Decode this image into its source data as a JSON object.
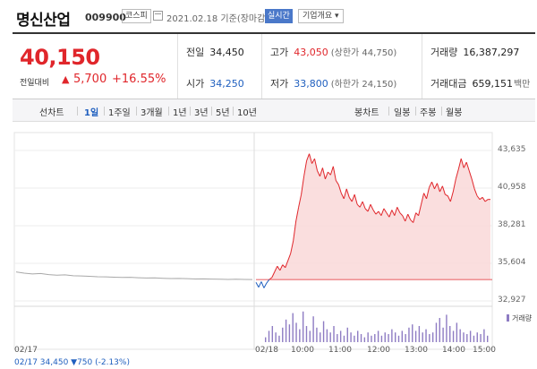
{
  "header": {
    "name": "명신산업",
    "code": "009900",
    "market": "코스피",
    "date": "2021.02.18 기준(장마감)",
    "realtime": "실시간",
    "company_info": "기업개요 ▾"
  },
  "quote": {
    "price": "40,150",
    "change_label": "전일대비",
    "change_arrow": "▲",
    "change": "5,700",
    "rate": "+16.55%",
    "prev_close_label": "전일",
    "prev_close": "34,450",
    "open_label": "시가",
    "open": "34,250",
    "high_label": "고가",
    "high": "43,050",
    "upper_limit": "(상한가 44,750)",
    "low_label": "저가",
    "low": "33,800",
    "lower_limit": "(하한가 24,150)",
    "volume_label": "거래량",
    "volume": "16,387,297",
    "amount_label": "거래대금",
    "amount": "659,151",
    "amount_unit": "백만"
  },
  "period_bar": {
    "line_chart_label": "선차트",
    "periods": [
      "1일",
      "1주일",
      "3개월",
      "1년",
      "3년",
      "5년",
      "10년"
    ],
    "active_period": "1일",
    "candle_chart_label": "봉차트",
    "candles": [
      "일봉",
      "주봉",
      "월봉"
    ]
  },
  "chart_data": {
    "type": "line",
    "y_ticks": [
      "43,635",
      "40,958",
      "38,281",
      "35,604",
      "32,927"
    ],
    "ylim": [
      32927,
      43635
    ],
    "x_ticks": [
      "02/17",
      "02/18",
      "10:00",
      "11:00",
      "12:00",
      "13:00",
      "14:00",
      "15:00"
    ],
    "reference_price": 34450,
    "colors": {
      "prev_day": "#a8a8a8",
      "up": "#e0262b",
      "down": "#1f5fbf",
      "fill": "#f9d8d8",
      "volume": "#8e7cc3"
    },
    "prev_day_series": [
      34990,
      34900,
      34850,
      34880,
      34800,
      34760,
      34780,
      34720,
      34700,
      34680,
      34650,
      34640,
      34620,
      34600,
      34610,
      34580,
      34560,
      34570,
      34540,
      34520,
      34530,
      34510,
      34490,
      34500,
      34480,
      34470,
      34460,
      34470,
      34455,
      34450
    ],
    "today_series": [
      34250,
      33900,
      34300,
      33850,
      34200,
      34450,
      34600,
      35000,
      35400,
      35100,
      35500,
      35300,
      35800,
      36300,
      37200,
      38600,
      39600,
      40500,
      41800,
      42900,
      43400,
      42700,
      43050,
      42200,
      41800,
      42400,
      41600,
      42100,
      41900,
      42500,
      41500,
      41200,
      40600,
      40200,
      40900,
      40300,
      40000,
      40500,
      39800,
      39600,
      40000,
      39500,
      39300,
      39800,
      39400,
      39100,
      39300,
      39000,
      39500,
      39200,
      38900,
      39400,
      39000,
      39600,
      39200,
      39000,
      38600,
      39100,
      38700,
      38500,
      39200,
      39000,
      39800,
      40600,
      40200,
      41000,
      41400,
      40900,
      41300,
      40700,
      41100,
      40500,
      40400,
      40000,
      40700,
      41600,
      42300,
      43050,
      42400,
      42800,
      42200,
      41600,
      40900,
      40400,
      40150,
      40300,
      40000,
      40150,
      40150
    ],
    "volume_series": [
      0.15,
      0.35,
      0.5,
      0.3,
      0.2,
      0.45,
      0.7,
      0.55,
      0.9,
      0.6,
      0.4,
      0.95,
      0.5,
      0.35,
      0.8,
      0.45,
      0.3,
      0.65,
      0.4,
      0.3,
      0.5,
      0.25,
      0.35,
      0.2,
      0.45,
      0.3,
      0.2,
      0.35,
      0.25,
      0.15,
      0.3,
      0.2,
      0.25,
      0.35,
      0.2,
      0.3,
      0.25,
      0.4,
      0.3,
      0.2,
      0.35,
      0.25,
      0.45,
      0.55,
      0.35,
      0.5,
      0.3,
      0.4,
      0.25,
      0.3,
      0.6,
      0.75,
      0.45,
      0.85,
      0.5,
      0.35,
      0.6,
      0.4,
      0.3,
      0.25,
      0.35,
      0.2,
      0.3,
      0.25,
      0.4,
      0.2
    ],
    "volume_legend": "거래량"
  },
  "footer": {
    "summary": "02/17  34,450 ▼750 (-2.13%)"
  }
}
